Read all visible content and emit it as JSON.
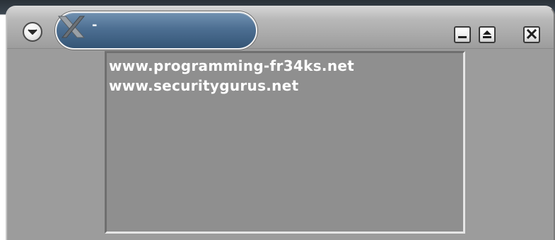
{
  "window": {
    "title": "-",
    "title_icon": "x-logo-icon",
    "menu_icon": "chevron-down-icon",
    "controls": {
      "minimize_icon": "minimize-icon",
      "maximize_icon": "maximize-icon",
      "close_icon": "close-icon"
    }
  },
  "content": {
    "lines": [
      "www.programming-fr34ks.net",
      "www.securitygurus.net"
    ]
  },
  "colors": {
    "window_bg": "#9c9c9c",
    "title_pill": "#4d6f92",
    "content_bg": "#8f8f8f",
    "text": "#ffffff"
  }
}
